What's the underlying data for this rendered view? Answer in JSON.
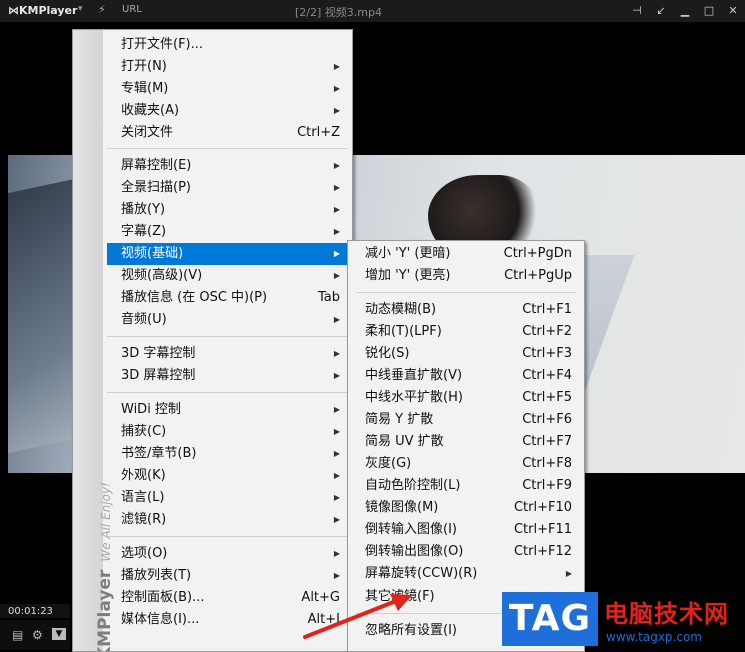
{
  "titlebar": {
    "app_name": "KMPlayer",
    "url_label": "URL",
    "file_title": "[2/2] 视频3.mp4"
  },
  "player": {
    "elapsed": "00:01:23"
  },
  "menu_strip": {
    "brand": "KMPlayer",
    "tagline": "We All Enjoy!"
  },
  "menu": {
    "items": [
      {
        "label": "打开文件(F)...",
        "shortcut": "",
        "submenu": false
      },
      {
        "label": "打开(N)",
        "shortcut": "",
        "submenu": true
      },
      {
        "label": "专辑(M)",
        "shortcut": "",
        "submenu": true
      },
      {
        "label": "收藏夹(A)",
        "shortcut": "",
        "submenu": true
      },
      {
        "label": "关闭文件",
        "shortcut": "Ctrl+Z",
        "submenu": false
      },
      {
        "label": "屏幕控制(E)",
        "shortcut": "",
        "submenu": true
      },
      {
        "label": "全景扫描(P)",
        "shortcut": "",
        "submenu": true
      },
      {
        "label": "播放(Y)",
        "shortcut": "",
        "submenu": true
      },
      {
        "label": "字幕(Z)",
        "shortcut": "",
        "submenu": true
      },
      {
        "label": "视频(基础)",
        "shortcut": "",
        "submenu": true
      },
      {
        "label": "视频(高级)(V)",
        "shortcut": "",
        "submenu": true
      },
      {
        "label": "播放信息 (在 OSC 中)(P)",
        "shortcut": "Tab",
        "submenu": false
      },
      {
        "label": "音频(U)",
        "shortcut": "",
        "submenu": true
      },
      {
        "label": "3D 字幕控制",
        "shortcut": "",
        "submenu": true
      },
      {
        "label": "3D 屏幕控制",
        "shortcut": "",
        "submenu": true
      },
      {
        "label": "WiDi 控制",
        "shortcut": "",
        "submenu": true
      },
      {
        "label": "捕获(C)",
        "shortcut": "",
        "submenu": true
      },
      {
        "label": "书签/章节(B)",
        "shortcut": "",
        "submenu": true
      },
      {
        "label": "外观(K)",
        "shortcut": "",
        "submenu": true
      },
      {
        "label": "语言(L)",
        "shortcut": "",
        "submenu": true
      },
      {
        "label": "滤镜(R)",
        "shortcut": "",
        "submenu": true
      },
      {
        "label": "选项(O)",
        "shortcut": "",
        "submenu": true
      },
      {
        "label": "播放列表(T)",
        "shortcut": "",
        "submenu": true
      },
      {
        "label": "控制面板(B)...",
        "shortcut": "Alt+G",
        "submenu": false
      },
      {
        "label": "媒体信息(I)...",
        "shortcut": "Alt+J",
        "submenu": false
      }
    ]
  },
  "submenu": {
    "items": [
      {
        "label": "减小 'Y' (更暗)",
        "shortcut": "Ctrl+PgDn",
        "submenu": false
      },
      {
        "label": "增加 'Y' (更亮)",
        "shortcut": "Ctrl+PgUp",
        "submenu": false
      },
      {
        "label": "动态模糊(B)",
        "shortcut": "Ctrl+F1",
        "submenu": false
      },
      {
        "label": "柔和(T)(LPF)",
        "shortcut": "Ctrl+F2",
        "submenu": false
      },
      {
        "label": "锐化(S)",
        "shortcut": "Ctrl+F3",
        "submenu": false
      },
      {
        "label": "中线垂直扩散(V)",
        "shortcut": "Ctrl+F4",
        "submenu": false
      },
      {
        "label": "中线水平扩散(H)",
        "shortcut": "Ctrl+F5",
        "submenu": false
      },
      {
        "label": "简易 Y 扩散",
        "shortcut": "Ctrl+F6",
        "submenu": false
      },
      {
        "label": "简易 UV 扩散",
        "shortcut": "Ctrl+F7",
        "submenu": false
      },
      {
        "label": "灰度(G)",
        "shortcut": "Ctrl+F8",
        "submenu": false
      },
      {
        "label": "自动色阶控制(L)",
        "shortcut": "Ctrl+F9",
        "submenu": false
      },
      {
        "label": "镜像图像(M)",
        "shortcut": "Ctrl+F10",
        "submenu": false
      },
      {
        "label": "倒转输入图像(I)",
        "shortcut": "Ctrl+F11",
        "submenu": false
      },
      {
        "label": "倒转输出图像(O)",
        "shortcut": "Ctrl+F12",
        "submenu": false
      },
      {
        "label": "屏幕旋转(CCW)(R)",
        "shortcut": "",
        "submenu": true
      },
      {
        "label": "其它滤镜(F)",
        "shortcut": "",
        "submenu": true
      },
      {
        "label": "忽略所有设置(I)",
        "shortcut": "",
        "submenu": false
      }
    ]
  },
  "watermark": {
    "tag": "TAG",
    "title": "电脑技术网",
    "url": "www.tagxp.com"
  },
  "colors": {
    "highlight": "#0078d7",
    "arrow": "#e2231a"
  }
}
